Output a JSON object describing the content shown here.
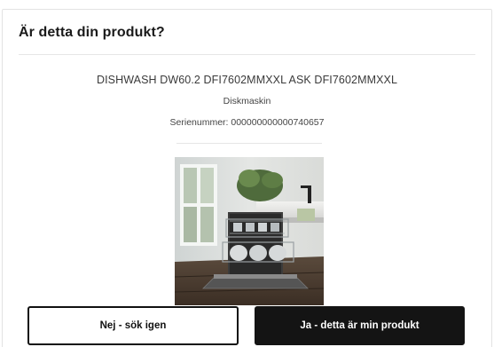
{
  "dialog": {
    "title": "Är detta din produkt?"
  },
  "product": {
    "name": "DISHWASH DW60.2 DFI7602MMXXL ASK DFI7602MMXXL",
    "type": "Diskmaskin",
    "serial": "Serienummer: 000000000000740657",
    "image_icon": "dishwasher-photo"
  },
  "actions": {
    "no_label": "Nej - sök igen",
    "yes_label": "Ja - detta är min produkt"
  },
  "colors": {
    "primary_button_bg": "#141414",
    "secondary_button_border": "#111111",
    "divider": "#e6e6e6"
  }
}
